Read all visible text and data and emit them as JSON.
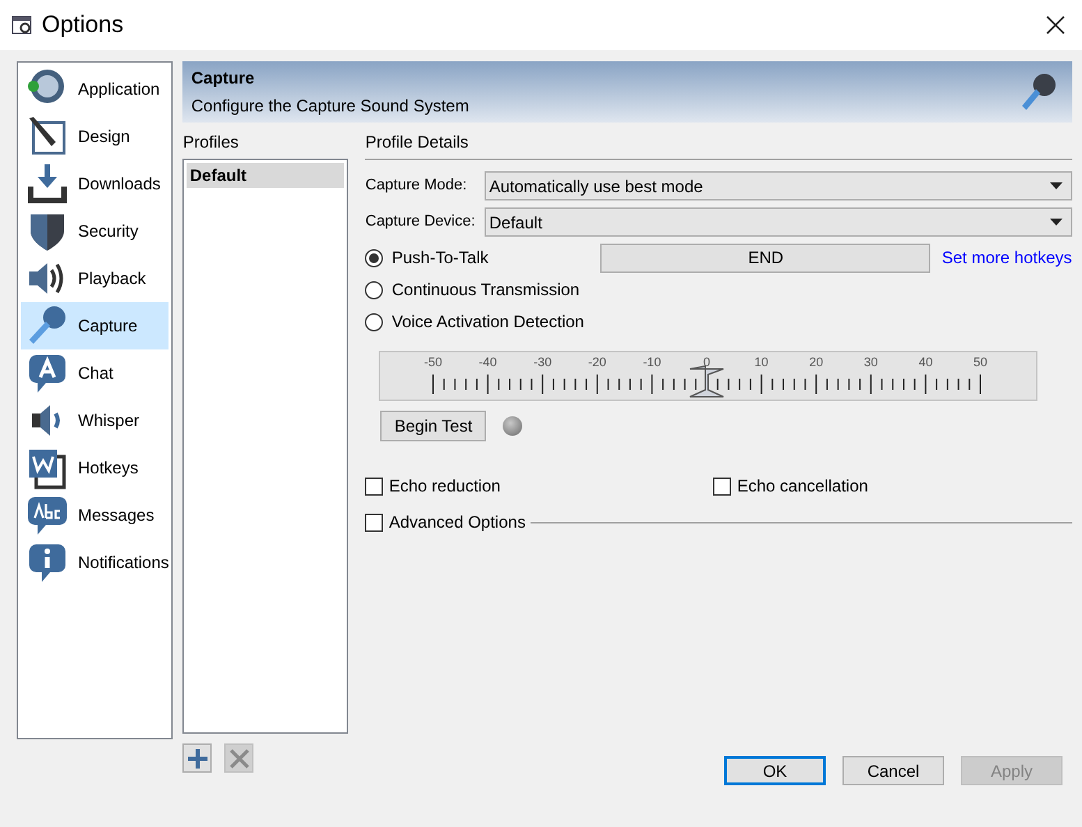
{
  "window": {
    "title": "Options"
  },
  "sidebar": {
    "items": [
      {
        "label": "Application",
        "selected": false
      },
      {
        "label": "Design",
        "selected": false
      },
      {
        "label": "Downloads",
        "selected": false
      },
      {
        "label": "Security",
        "selected": false
      },
      {
        "label": "Playback",
        "selected": false
      },
      {
        "label": "Capture",
        "selected": true
      },
      {
        "label": "Chat",
        "selected": false
      },
      {
        "label": "Whisper",
        "selected": false
      },
      {
        "label": "Hotkeys",
        "selected": false
      },
      {
        "label": "Messages",
        "selected": false
      },
      {
        "label": "Notifications",
        "selected": false
      }
    ]
  },
  "header": {
    "title": "Capture",
    "subtitle": "Configure the Capture Sound System"
  },
  "profiles": {
    "label": "Profiles",
    "items": [
      {
        "label": "Default",
        "selected": true
      }
    ],
    "buttons": [
      {
        "kind": "add",
        "disabled": false
      },
      {
        "kind": "remove",
        "disabled": true
      }
    ]
  },
  "details": {
    "label": "Profile Details",
    "fields": [
      {
        "label": "Capture Mode:",
        "value": "Automatically use best mode"
      },
      {
        "label": "Capture Device:",
        "value": "Default"
      }
    ],
    "modes": [
      {
        "label": "Push-To-Talk",
        "selected": true
      },
      {
        "label": "Continuous Transmission",
        "selected": false
      },
      {
        "label": "Voice Activation Detection",
        "selected": false
      }
    ],
    "hotkey": {
      "value": "END",
      "link": "Set more hotkeys"
    },
    "slider": {
      "scale": [
        "-50",
        "-40",
        "-30",
        "-20",
        "-10",
        "0",
        "10",
        "20",
        "30",
        "40",
        "50"
      ],
      "level": 0.5
    },
    "test": {
      "button": "Begin Test",
      "lit": false
    },
    "options": [
      {
        "label": "Echo reduction",
        "checked": false
      },
      {
        "label": "Echo cancellation",
        "checked": false
      }
    ],
    "advanced": {
      "label": "Advanced Options",
      "checked": false
    }
  },
  "buttons": [
    {
      "label": "OK",
      "default": true,
      "disabled": false
    },
    {
      "label": "Cancel",
      "default": false,
      "disabled": false
    },
    {
      "label": "Apply",
      "default": false,
      "disabled": true
    }
  ]
}
